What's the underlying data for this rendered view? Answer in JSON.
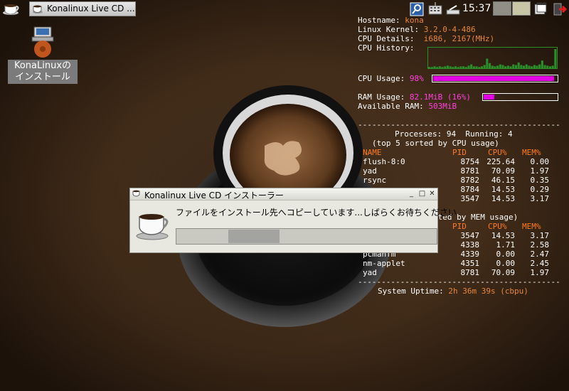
{
  "taskbar": {
    "task_button_label": "Konalinux Live CD ...",
    "clock": "15:37",
    "icons": [
      "menu-cup-icon",
      "search-icon",
      "keyboard-icon",
      "network-icon",
      "workspace-1",
      "workspace-2",
      "window-list-icon",
      "logout-icon"
    ]
  },
  "desktop_icon": {
    "label_line1": "KonaLinuxの",
    "label_line2": "インストール"
  },
  "conky": {
    "hostname_label": "Hostname:",
    "hostname": "kona",
    "kernel_label": "Linux Kernel:",
    "kernel": "3.2.0-4-486",
    "cpu_details_label": "CPU Details:",
    "cpu_details": "i686, 2167(MHz)",
    "cpu_history_label": "CPU History:",
    "cpu_history": [
      2,
      2,
      3,
      2,
      3,
      2,
      3,
      4,
      3,
      2,
      3,
      2,
      3,
      3,
      2,
      4,
      6,
      3,
      3,
      2,
      3,
      5,
      15,
      8,
      4,
      3,
      4,
      6,
      5,
      3,
      4,
      3,
      6,
      5,
      9,
      5,
      4,
      6,
      4,
      3,
      5,
      4,
      6,
      12,
      5,
      4,
      3,
      4,
      30
    ],
    "cpu_usage_label": "CPU Usage:",
    "cpu_usage": "98%",
    "cpu_usage_fraction": 0.98,
    "ram_usage_label": "RAM Usage:",
    "ram_usage": "82.1MiB (16%)",
    "ram_usage_fraction": 0.16,
    "available_ram_label": "Available RAM:",
    "available_ram": "503MiB",
    "divider": "-------------------------------------------",
    "processes_line": "Processes: 94  Running: 4",
    "cpu_sort_line": "(top 5 sorted by CPU usage)",
    "mem_sort_fragment": "rted by MEM usage)",
    "headers": {
      "name": "NAME",
      "pid": "PID",
      "cpu": "CPU%",
      "mem": "MEM%"
    },
    "cpu_rows": [
      {
        "name": "flush-8:0",
        "pid": "8754",
        "cpu": "225.64",
        "mem": "0.00"
      },
      {
        "name": "yad",
        "pid": "8781",
        "cpu": "70.09",
        "mem": "1.97"
      },
      {
        "name": "rsync",
        "pid": "8782",
        "cpu": "46.15",
        "mem": "0.35"
      },
      {
        "name": "",
        "pid": "8784",
        "cpu": "14.53",
        "mem": "0.29"
      },
      {
        "name": "",
        "pid": "3547",
        "cpu": "14.53",
        "mem": "3.17"
      }
    ],
    "mem_headers": {
      "pid": "PID",
      "cpu": "CPU%",
      "mem": "MEM%"
    },
    "mem_rows": [
      {
        "name": "",
        "pid": "3547",
        "cpu": "14.53",
        "mem": "3.17"
      },
      {
        "name": "",
        "pid": "4338",
        "cpu": "1.71",
        "mem": "2.58"
      },
      {
        "name": "pcmanfm",
        "pid": "4339",
        "cpu": "0.00",
        "mem": "2.47"
      },
      {
        "name": "nm-applet",
        "pid": "4351",
        "cpu": "0.00",
        "mem": "2.45"
      },
      {
        "name": "yad",
        "pid": "8781",
        "cpu": "70.09",
        "mem": "1.97"
      }
    ],
    "uptime_label": "System Uptime:",
    "uptime": "2h 36m 39s (cbpu)"
  },
  "dialog": {
    "title": "Konalinux Live CD インストーラー",
    "message": "ファイルをインストール先へコピーしています...しばらくお待ちください",
    "minimize": "_",
    "maximize": "□",
    "close": "✕"
  },
  "colors": {
    "accent_magenta": "#e400e4",
    "conky_orange": "#e8873a",
    "graph_green": "#2a8f2a"
  }
}
